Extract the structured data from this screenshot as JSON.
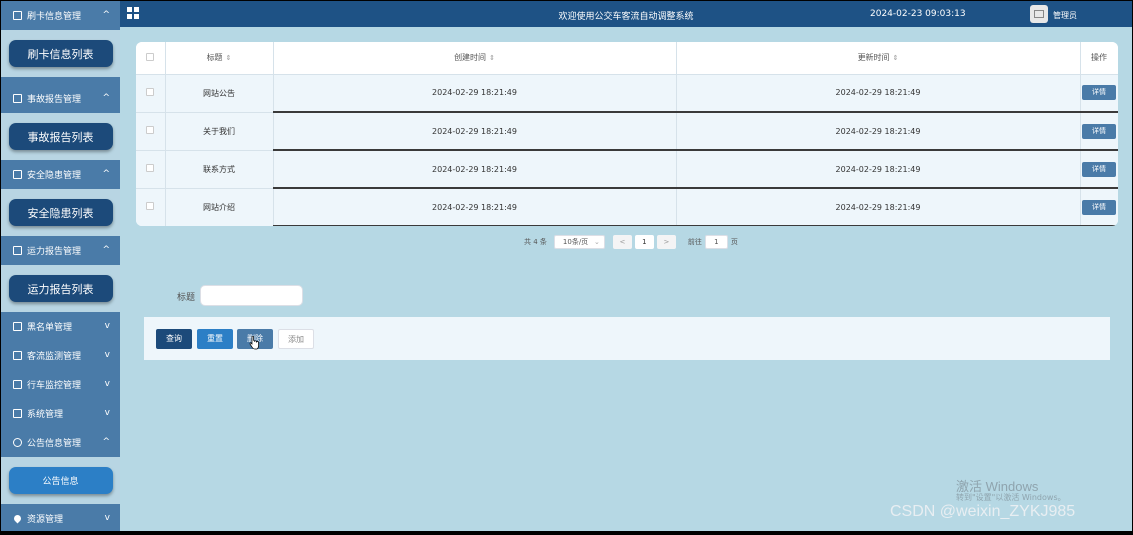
{
  "sidebar": {
    "groups": [
      {
        "label": "刷卡信息管理",
        "chevron": "^",
        "expanded": true,
        "sub": "刷卡信息列表"
      },
      {
        "label": "事故报告管理",
        "chevron": "^",
        "expanded": true,
        "sub": "事故报告列表"
      },
      {
        "label": "安全隐患管理",
        "chevron": "^",
        "expanded": true,
        "sub": "安全隐患列表"
      },
      {
        "label": "运力报告管理",
        "chevron": "^",
        "expanded": true,
        "sub": "运力报告列表"
      },
      {
        "label": "黑名单管理",
        "chevron": "v"
      },
      {
        "label": "客流监测管理",
        "chevron": "v"
      },
      {
        "label": "行车监控管理",
        "chevron": "v"
      },
      {
        "label": "系统管理",
        "chevron": "v"
      },
      {
        "label": "公告信息管理",
        "chevron": "^",
        "expanded": true,
        "sub": "公告信息"
      },
      {
        "label": "资源管理",
        "chevron": "v"
      }
    ]
  },
  "topbar": {
    "title": "欢迎使用公交车客流自动调整系统",
    "datetime": "2024-02-23 09:03:13",
    "user": "管理员"
  },
  "table": {
    "headers": {
      "title": "标题",
      "created": "创建时间",
      "updated": "更新时间",
      "op": "操作"
    },
    "rows": [
      {
        "title": "网站公告",
        "created": "2024-02-29 18:21:49",
        "updated": "2024-02-29 18:21:49",
        "action": "详情"
      },
      {
        "title": "关于我们",
        "created": "2024-02-29 18:21:49",
        "updated": "2024-02-29 18:21:49",
        "action": "详情"
      },
      {
        "title": "联系方式",
        "created": "2024-02-29 18:21:49",
        "updated": "2024-02-29 18:21:49",
        "action": "详情"
      },
      {
        "title": "网站介绍",
        "created": "2024-02-29 18:21:49",
        "updated": "2024-02-29 18:21:49",
        "action": "详情"
      }
    ]
  },
  "pager": {
    "total": "共 4 条",
    "page_size": "10条/页",
    "prev": "<",
    "current": "1",
    "next": ">",
    "goto_label": "前往",
    "goto_value": "1",
    "goto_suffix": "页"
  },
  "search": {
    "label": "标题",
    "value": ""
  },
  "actions": {
    "query": "查询",
    "reset": "重置",
    "delete": "删除",
    "add": "添加"
  },
  "watermark": {
    "activate_title": "激活 Windows",
    "activate_sub": "转到\"设置\"以激活 Windows。",
    "csdn": "CSDN @weixin_ZYKJ985"
  },
  "colors": {
    "sidebar": "#4a7ba8",
    "topbar": "#1e5285",
    "main_bg": "#b6d8e4",
    "primary_button": "#1c4a7a"
  }
}
